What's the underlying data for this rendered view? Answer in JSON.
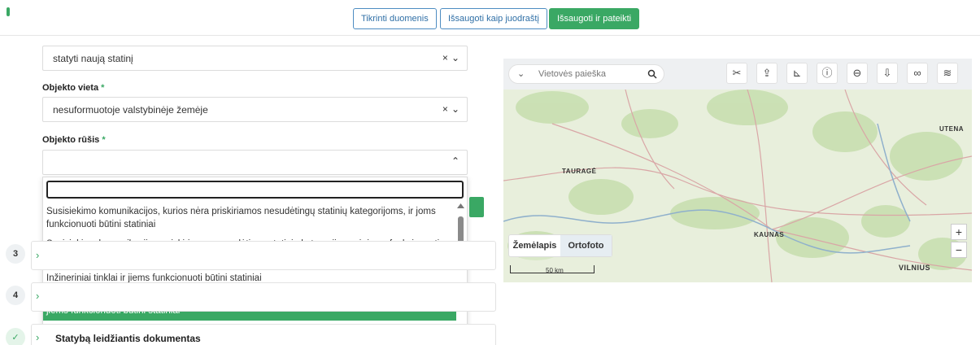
{
  "header": {
    "check_button": "Tikrinti duomenis",
    "draft_button": "Išsaugoti kaip juodraštį",
    "submit_button": "Išsaugoti ir pateikti"
  },
  "form": {
    "first_select_value": "statyti naują statinį",
    "clear_symbol": "×",
    "chevron_down": "⌄",
    "chevron_up": "⌃",
    "location_label": "Objekto vieta",
    "location_value": "nesuformuotoje valstybinėje žemėje",
    "type_label": "Objekto rūšis",
    "required_mark": "*"
  },
  "dropdown": {
    "options": [
      "Susisiekimo komunikacijos, kurios nėra priskiriamos nesudėtingų statinių kategorijoms, ir joms funkcionuoti būtini statiniai",
      "Susisiekimo komunikacijos, priskiriamos nesudėtingų statinių kategorijoms, ir joms funkcionuoti būtini statiniai",
      "Inžineriniai tinklai ir jiems funkcionuoti būtini statiniai",
      "Vietiniai inžineriniai tinklai, reikalingi konkrečiam įrenginiui aptarnauti, nepriskirti statiniams, ir jiems funkcionuoti būtini statiniai"
    ],
    "active_index": 3
  },
  "steps": [
    {
      "number": "3",
      "title": ""
    },
    {
      "number": "4",
      "title": ""
    },
    {
      "number": "✓",
      "title": "Statybą leidžiantis dokumentas"
    }
  ],
  "map": {
    "search_placeholder": "Vietovės paieška",
    "toggle_map": "Žemėlapis",
    "toggle_ortho": "Ortofoto",
    "scale_label": "50 km",
    "zoom_in": "+",
    "zoom_out": "−",
    "cities": [
      "TAURAGĖ",
      "UTENA",
      "KAUNAS",
      "VILNIUS"
    ],
    "tool_icons": [
      "measure-icon",
      "import-icon",
      "angle-icon",
      "info-icon",
      "link-icon",
      "export-icon",
      "chain-icon",
      "layers-icon"
    ]
  },
  "colors": {
    "accent_green": "#3aa864",
    "primary_blue": "#2f6fa6"
  }
}
